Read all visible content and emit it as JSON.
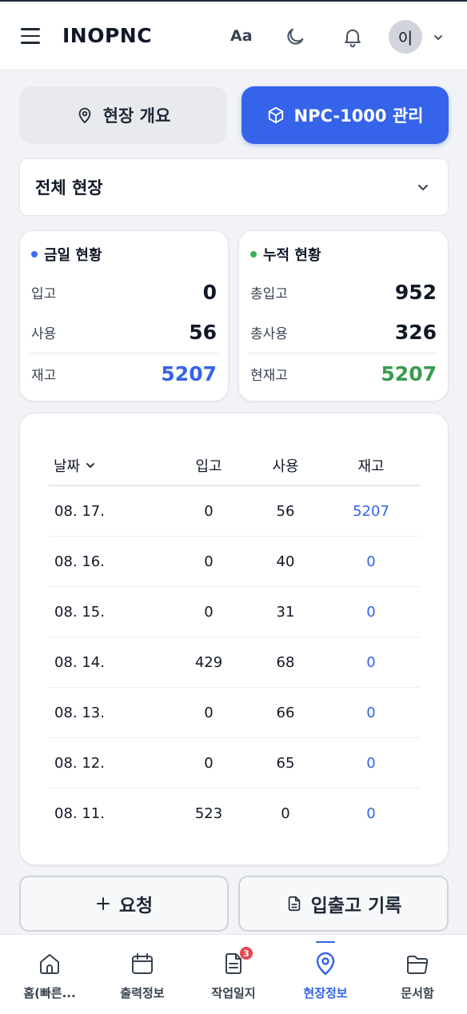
{
  "header": {
    "logo": "INOPNC",
    "font_toggle": "Aa",
    "avatar_initial": "이"
  },
  "tabs": {
    "overview": "현장 개요",
    "npc": "NPC-1000 관리",
    "active_tab": "npc"
  },
  "site_select": {
    "value": "전체 현장"
  },
  "today": {
    "title": "금일 현황",
    "dot_color": "#3b6ef5",
    "rows": [
      {
        "label": "입고",
        "value": "0"
      },
      {
        "label": "사용",
        "value": "56"
      },
      {
        "label": "재고",
        "value": "5207"
      }
    ],
    "highlight_color": "#3563e9"
  },
  "cumulative": {
    "title": "누적 현황",
    "dot_color": "#3fae57",
    "rows": [
      {
        "label": "총입고",
        "value": "952"
      },
      {
        "label": "총사용",
        "value": "326"
      },
      {
        "label": "현재고",
        "value": "5207"
      }
    ],
    "highlight_color": "#3a9a4e"
  },
  "table": {
    "headers": {
      "date": "날짜",
      "in": "입고",
      "use": "사용",
      "stock": "재고"
    },
    "rows": [
      {
        "date": "08. 17.",
        "in": "0",
        "use": "56",
        "stock": "5207"
      },
      {
        "date": "08. 16.",
        "in": "0",
        "use": "40",
        "stock": "0"
      },
      {
        "date": "08. 15.",
        "in": "0",
        "use": "31",
        "stock": "0"
      },
      {
        "date": "08. 14.",
        "in": "429",
        "use": "68",
        "stock": "0"
      },
      {
        "date": "08. 13.",
        "in": "0",
        "use": "66",
        "stock": "0"
      },
      {
        "date": "08. 12.",
        "in": "0",
        "use": "65",
        "stock": "0"
      },
      {
        "date": "08. 11.",
        "in": "523",
        "use": "0",
        "stock": "0"
      }
    ]
  },
  "actions": {
    "request": "요청",
    "log": "입출고 기록"
  },
  "nav": {
    "items": [
      {
        "label": "홈(빠른...",
        "icon": "home-icon"
      },
      {
        "label": "출력정보",
        "icon": "calendar-icon"
      },
      {
        "label": "작업일지",
        "icon": "document-icon",
        "badge": "3"
      },
      {
        "label": "현장정보",
        "icon": "map-pin-icon"
      },
      {
        "label": "문서함",
        "icon": "folder-icon"
      }
    ],
    "active_index": 3,
    "accent_color": "#3563e9"
  }
}
